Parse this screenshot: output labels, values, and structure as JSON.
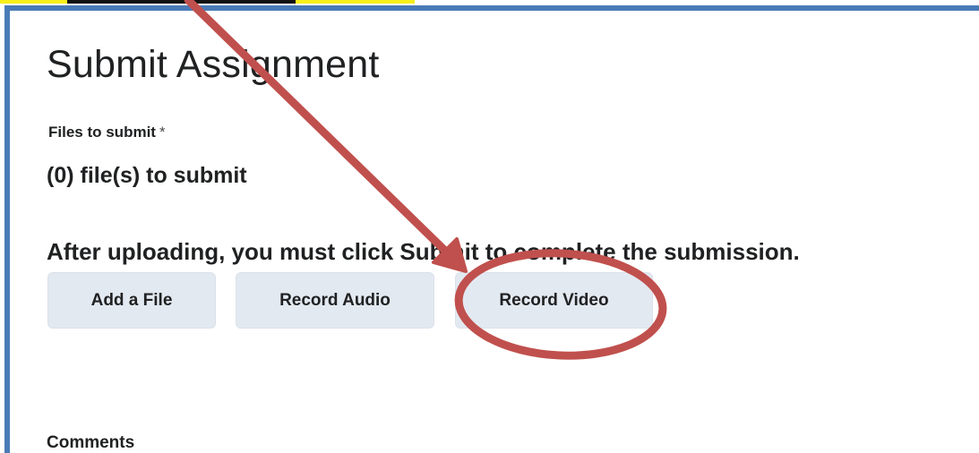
{
  "page": {
    "title": "Submit Assignment",
    "files_label": "Files to submit",
    "required_marker": "*",
    "files_count_text": "(0) file(s) to submit",
    "notice": "After uploading, you must click Submit to complete the submission.",
    "comments_label": "Comments"
  },
  "buttons": {
    "add_file": "Add a File",
    "record_audio": "Record Audio",
    "record_video": "Record Video"
  },
  "colors": {
    "frame_border": "#4a7bb7",
    "button_bg": "#e3e9f1",
    "annotation": "#c0504d",
    "highlight": "#f7ef1a"
  },
  "annotations": {
    "arrow_target": "record-video-button",
    "circle_target": "record-video-button"
  }
}
